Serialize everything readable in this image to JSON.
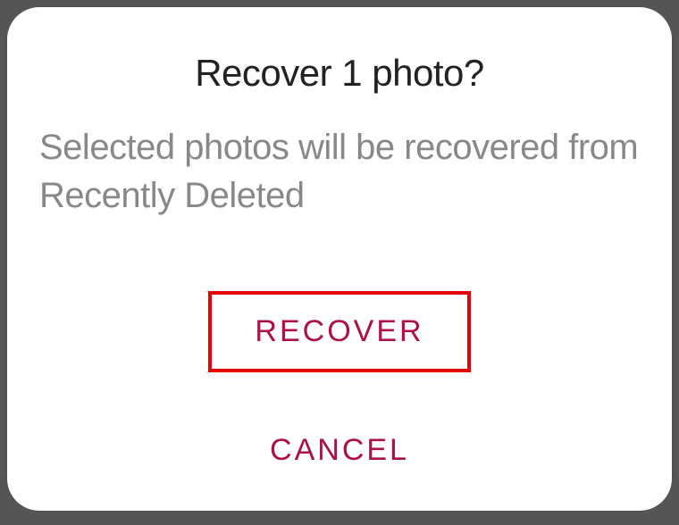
{
  "dialog": {
    "title": "Recover 1 photo?",
    "message": "Selected photos will be recovered from Recently Deleted",
    "recover_label": "RECOVER",
    "cancel_label": "CANCEL"
  }
}
